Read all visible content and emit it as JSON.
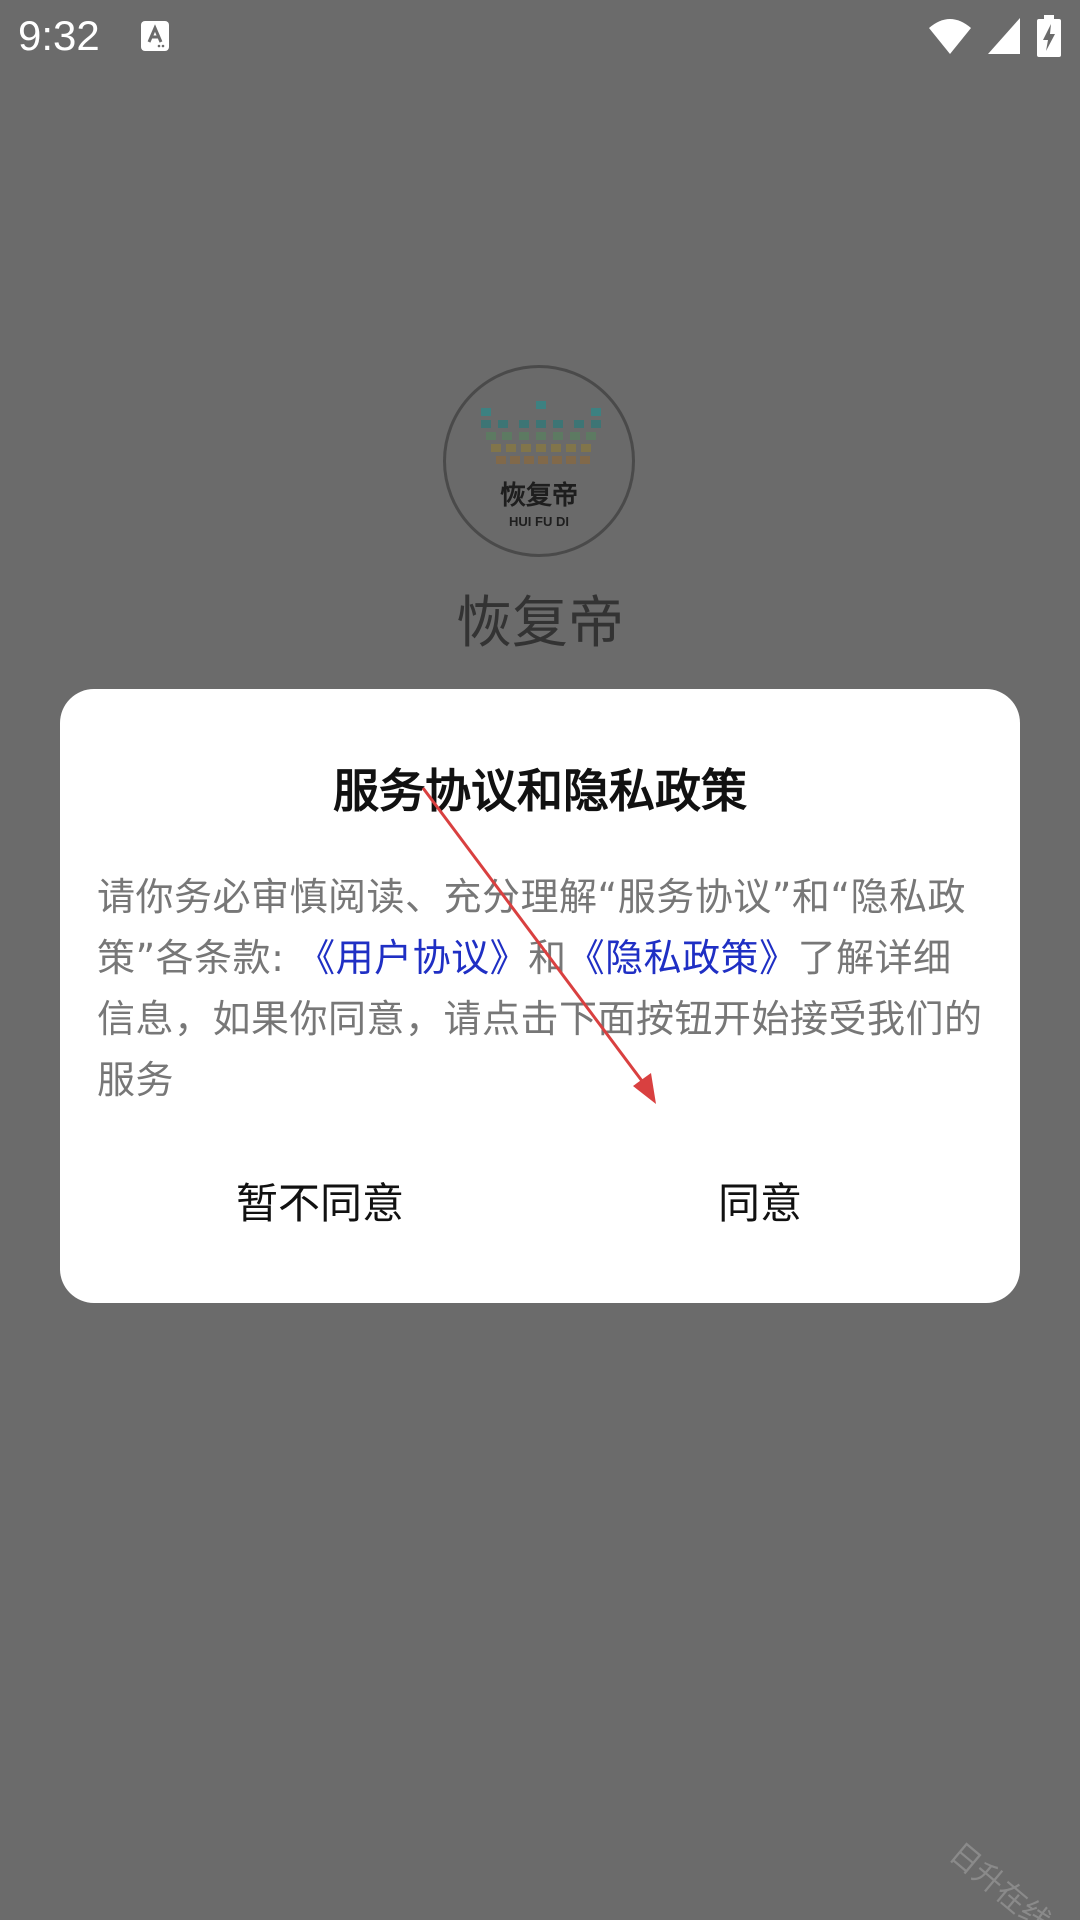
{
  "status_bar": {
    "time": "9:32",
    "notification_icon": "text-a-icon",
    "icons": [
      "wifi-icon",
      "signal-icon",
      "battery-charging-icon"
    ]
  },
  "app": {
    "logo_main_text": "恢复帝",
    "logo_sub_text": "HUI FU DI",
    "name": "恢复帝"
  },
  "dialog": {
    "title": "服务协议和隐私政策",
    "body_part1": "请你务必审慎阅读、充分理解“服务协议”和“隐私政策”各条款: ",
    "link_user_agreement": "《用户协议》",
    "body_part2": "和",
    "link_privacy_policy": "《隐私政策》",
    "body_part3": "了解详细信息，如果你同意，请点击下面按钮开始接受我们的服务",
    "disagree_label": "暂不同意",
    "agree_label": "同意"
  },
  "watermark": "日升在线",
  "colors": {
    "overlay": "#6b6b6b",
    "link": "#1f2fc4",
    "annotation_arrow": "#d94040"
  }
}
